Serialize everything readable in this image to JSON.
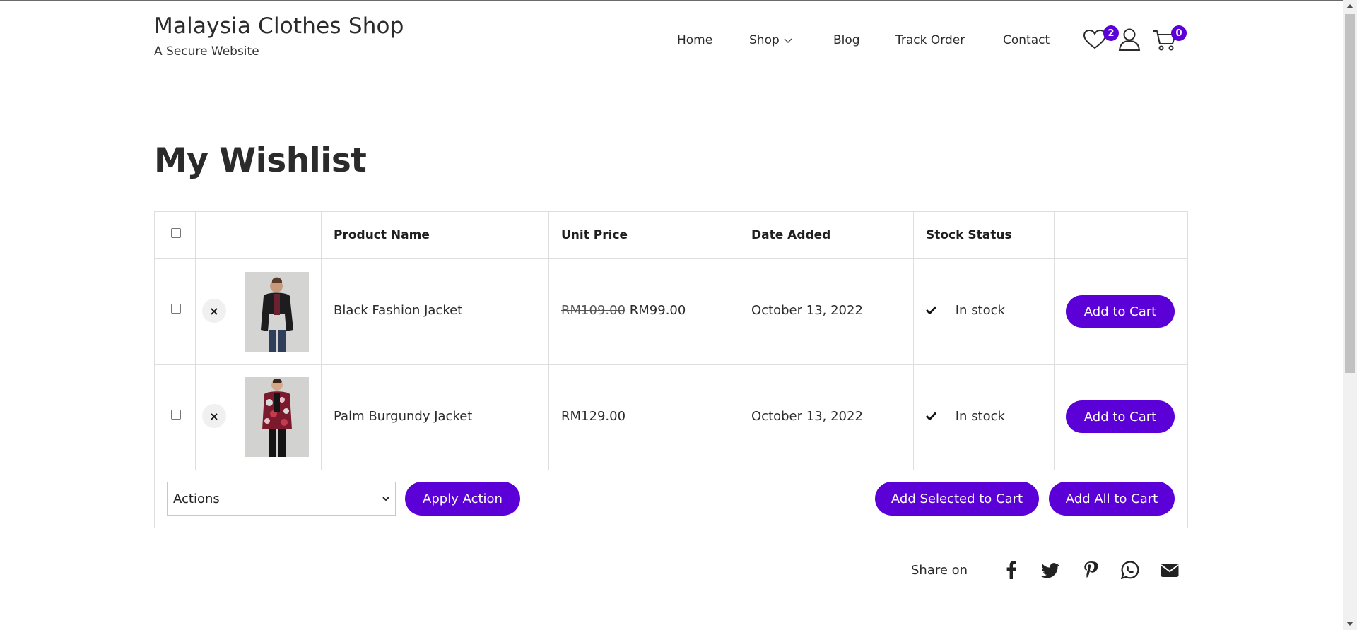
{
  "site": {
    "title": "Malaysia Clothes Shop",
    "tagline": "A Secure Website"
  },
  "nav": {
    "home": "Home",
    "shop": "Shop",
    "blog": "Blog",
    "track_order": "Track Order",
    "contact": "Contact"
  },
  "header_icons": {
    "wishlist_count": "2",
    "cart_count": "0",
    "wishlist_icon": "heart-icon",
    "account_icon": "user-icon",
    "cart_icon": "cart-icon"
  },
  "page": {
    "title": "My Wishlist"
  },
  "table": {
    "headers": {
      "product_name": "Product Name",
      "unit_price": "Unit Price",
      "date_added": "Date Added",
      "stock_status": "Stock Status"
    },
    "rows": [
      {
        "name": "Black Fashion Jacket",
        "old_price": "RM109.00",
        "price": "RM99.00",
        "date": "October 13, 2022",
        "stock": "In stock",
        "button": "Add to Cart",
        "remove": "×"
      },
      {
        "name": "Palm Burgundy Jacket",
        "old_price": "",
        "price": "RM129.00",
        "date": "October 13, 2022",
        "stock": "In stock",
        "button": "Add to Cart",
        "remove": "×"
      }
    ]
  },
  "actions": {
    "select_value": "Actions",
    "apply": "Apply Action",
    "add_selected": "Add Selected to Cart",
    "add_all": "Add All to Cart"
  },
  "share": {
    "label": "Share on",
    "icons": [
      "facebook-icon",
      "twitter-icon",
      "pinterest-icon",
      "whatsapp-icon",
      "email-icon"
    ]
  },
  "colors": {
    "accent": "#5b00d6",
    "text": "#2b2b2b",
    "border": "#dedede"
  }
}
